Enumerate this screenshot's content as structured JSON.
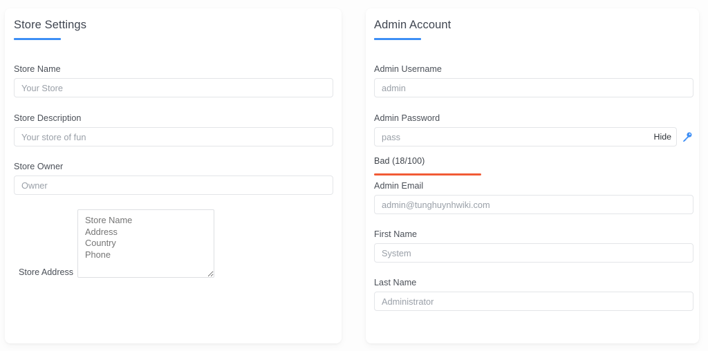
{
  "theme": {
    "accent_blue": "#3d8ef5",
    "strength_bad": "#f15a35",
    "card_bg": "#ffffff",
    "page_bg": "#fdfdfd",
    "input_border": "#e3e5e8",
    "label_color": "#4a4f57"
  },
  "store_settings": {
    "title": "Store Settings",
    "store_name": {
      "label": "Store Name",
      "value": "",
      "placeholder": "Your Store"
    },
    "store_description": {
      "label": "Store Description",
      "value": "",
      "placeholder": "Your store of fun"
    },
    "store_owner": {
      "label": "Store Owner",
      "value": "",
      "placeholder": "Owner"
    },
    "store_address": {
      "label": "Store Address",
      "value": "",
      "placeholder": "Store Name\nAddress\nCountry\nPhone"
    }
  },
  "admin_account": {
    "title": "Admin Account",
    "admin_username": {
      "label": "Admin Username",
      "value": "",
      "placeholder": "admin"
    },
    "admin_password": {
      "label": "Admin Password",
      "value": "",
      "placeholder": "pass",
      "toggle_label": "Hide",
      "key_icon": "key-icon",
      "strength_text": "Bad (18/100)",
      "strength_score": 18,
      "strength_max": 100,
      "strength_rating": "Bad"
    },
    "admin_email": {
      "label": "Admin Email",
      "value": "",
      "placeholder": "admin@tunghuynhwiki.com"
    },
    "first_name": {
      "label": "First Name",
      "value": "",
      "placeholder": "System"
    },
    "last_name": {
      "label": "Last Name",
      "value": "",
      "placeholder": "Administrator"
    }
  }
}
